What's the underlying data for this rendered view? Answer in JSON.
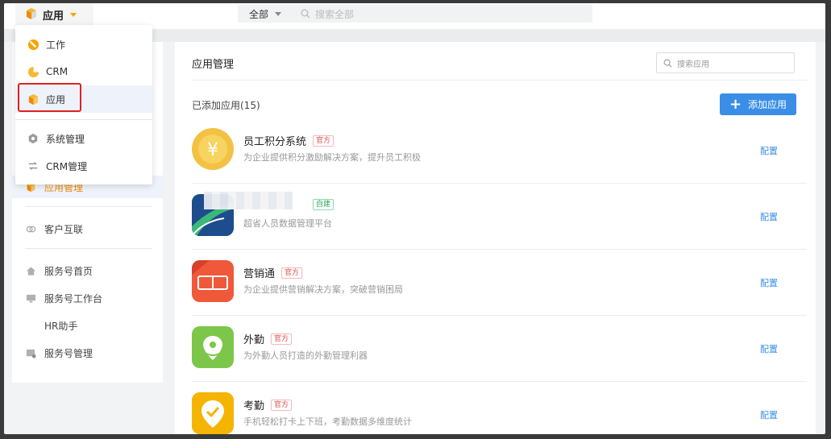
{
  "topbar": {
    "app_label": "应用",
    "scope_label": "全部",
    "search_placeholder": "搜索全部"
  },
  "dropdown": {
    "items": [
      {
        "label": "工作",
        "icon": "work-icon"
      },
      {
        "label": "CRM",
        "icon": "crm-icon"
      },
      {
        "label": "应用",
        "icon": "app-cube-icon",
        "selected": true
      },
      {
        "label": "系统管理",
        "icon": "gear-icon"
      },
      {
        "label": "CRM管理",
        "icon": "crm-manage-icon"
      }
    ]
  },
  "sidebar": {
    "items": [
      {
        "label": "应用管理",
        "icon": "app-cube-icon",
        "active": true
      },
      {
        "label": "客户互联",
        "icon": "link-icon"
      },
      {
        "label": "服务号首页",
        "icon": "home-icon"
      },
      {
        "label": "服务号工作台",
        "icon": "monitor-icon"
      },
      {
        "label": "HR助手",
        "icon": ""
      },
      {
        "label": "服务号管理",
        "icon": "manage-icon"
      }
    ]
  },
  "main": {
    "title": "应用管理",
    "search_placeholder": "搜索应用",
    "added_label": "已添加应用(15)",
    "add_button": "添加应用",
    "apps": [
      {
        "name": "员工积分系统",
        "badge": "官方",
        "desc": "为企业提供积分激励解决方案，提升员工积极",
        "action": "配置",
        "icon": "yen-coin-icon"
      },
      {
        "name": "",
        "badge": "自建",
        "desc": "超省人员数据管理平台",
        "action": "配置",
        "icon": "custom-app-icon"
      },
      {
        "name": "营销通",
        "badge": "官方",
        "desc": "为企业提供营销解决方案，突破营销困局",
        "action": "配置",
        "icon": "marketing-icon"
      },
      {
        "name": "外勤",
        "badge": "官方",
        "desc": "为外勤人员打造的外勤管理利器",
        "action": "配置",
        "icon": "location-pin-icon"
      },
      {
        "name": "考勤",
        "badge": "官方",
        "desc": "手机轻松打卡上下班，考勤数据多维度统计",
        "action": "配置",
        "icon": "checkin-icon"
      }
    ]
  },
  "colors": {
    "accent": "#3a8ee6",
    "brand_orange": "#f08a00",
    "highlight_red": "#e02020"
  }
}
